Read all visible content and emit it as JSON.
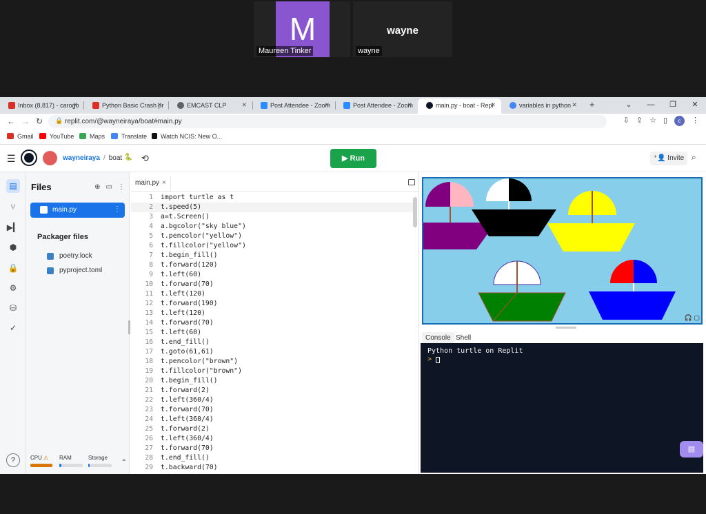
{
  "zoom": {
    "participants": [
      {
        "initial": "M",
        "name": "Maureen Tinker"
      },
      {
        "display": "wayne",
        "name": "wayne"
      }
    ]
  },
  "browser": {
    "tabs": [
      {
        "label": "Inbox (8,817) - carogo",
        "icon": "gmail-icon",
        "color": "#d93025"
      },
      {
        "label": "Python Basic Crash pr",
        "icon": "gmail-icon",
        "color": "#d93025"
      },
      {
        "label": "EMCAST CLP",
        "icon": "globe-icon",
        "color": "#5f6368"
      },
      {
        "label": "Post Attendee - Zoom",
        "icon": "zoom-icon",
        "color": "#2d8cff"
      },
      {
        "label": "Post Attendee - Zoom",
        "icon": "zoom-icon",
        "color": "#2d8cff"
      },
      {
        "label": "main.py - boat - Repl",
        "icon": "replit-icon",
        "color": "#0e1525"
      },
      {
        "label": "variables in python -",
        "icon": "google-icon",
        "color": "#4285f4"
      }
    ],
    "new_tab": "+",
    "window_controls": {
      "expand": "⌄",
      "minimize": "—",
      "restore": "❐",
      "close": "✕"
    },
    "url": "replit.com/@wayneiraya/boat#main.py",
    "bookmarks": [
      {
        "label": "Gmail",
        "color": "#d93025"
      },
      {
        "label": "YouTube",
        "color": "#ff0000"
      },
      {
        "label": "Maps",
        "color": "#34a853"
      },
      {
        "label": "Translate",
        "color": "#4285f4"
      },
      {
        "label": "Watch NCIS: New O...",
        "color": "#111111"
      }
    ],
    "profile_initial": "c"
  },
  "replit": {
    "user": "wayneiraya",
    "repl": "boat",
    "crumb_sep": "/",
    "run_label": "Run",
    "invite_label": "Invite",
    "files_title": "Files",
    "active_file": "main.py",
    "packager_title": "Packager files",
    "packager_files": [
      "poetry.lock",
      "pyproject.toml"
    ],
    "resources": {
      "cpu": "CPU",
      "ram": "RAM",
      "storage": "Storage",
      "cpu_level": 1.0,
      "ram_level": 0.08,
      "storage_level": 0.05
    },
    "editor_tab": "main.py",
    "code": [
      "import turtle as t",
      "t.speed(5)",
      "a=t.Screen()",
      "a.bgcolor(\"sky blue\")",
      "t.pencolor(\"yellow\")",
      "t.fillcolor(\"yellow\")",
      "t.begin_fill()",
      "t.forward(120)",
      "t.left(60)",
      "t.forward(70)",
      "t.left(120)",
      "t.forward(190)",
      "t.left(120)",
      "t.forward(70)",
      "t.left(60)",
      "t.end_fill()",
      "t.goto(61,61)",
      "t.pencolor(\"brown\")",
      "t.fillcolor(\"brown\")",
      "t.begin_fill()",
      "t.forward(2)",
      "t.left(360/4)",
      "t.forward(70)",
      "t.left(360/4)",
      "t.forward(2)",
      "t.left(360/4)",
      "t.forward(70)",
      "t.end_fill()",
      "t.backward(70)"
    ],
    "current_line": 2,
    "console_tabs": [
      "Console",
      "Shell"
    ],
    "console_output": "Python turtle on Replit",
    "console_prompt": ">",
    "colors": {
      "run": "#1aa34a",
      "accent": "#1a73e8",
      "canvas_bg": "#87ceeb",
      "console_bg": "#0e1525"
    }
  }
}
